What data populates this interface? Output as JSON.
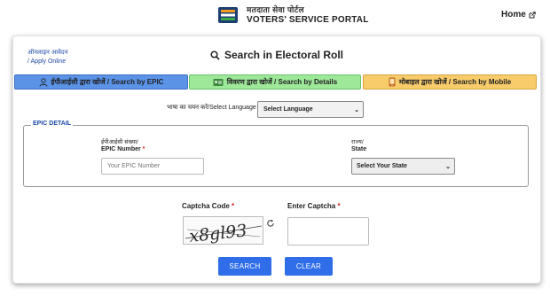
{
  "header": {
    "portal_name_hi": "मतदाता सेवा पोर्टल",
    "portal_name_en": "VOTERS' SERVICE PORTAL",
    "home_label": "Home",
    "logo_icon": "eci-logo-icon",
    "home_icon": "external-link-icon"
  },
  "card": {
    "apply_online_hi": "ऑनलाइन आवेदन",
    "apply_online_en": "/ Apply Online",
    "title": "Search in Electoral Roll",
    "title_icon": "search-icon"
  },
  "tabs": [
    {
      "label": "ईपीआईसी द्वारा खोजें / Search by EPIC",
      "icon": "user-icon",
      "color": "#5b93e7",
      "active": true
    },
    {
      "label": "विवरण द्वारा खोजें / Search by Details",
      "icon": "id-card-icon",
      "color": "#9ee89a",
      "active": false
    },
    {
      "label": "मोबाइल द्वारा खोजें / Search by Mobile",
      "icon": "mobile-icon",
      "color": "#f8cb6b",
      "active": false
    }
  ],
  "language": {
    "label": "भाषा का चयन करें/Select Language",
    "selected": "Select Language"
  },
  "epic_detail": {
    "legend": "EPIC DETAIL",
    "epic_label_hi": "ईपीआईसी संख्या/",
    "epic_label_en": "EPIC Number",
    "epic_placeholder": "Your EPIC Number",
    "state_label_hi": "राज्य/",
    "state_label_en": "State",
    "state_selected": "Select Your State"
  },
  "captcha": {
    "code_label": "Captcha Code",
    "input_label": "Enter Captcha",
    "code_text": "x8gl93",
    "refresh_icon": "refresh-icon"
  },
  "buttons": {
    "search": "SEARCH",
    "clear": "CLEAR"
  },
  "colors": {
    "primary_button": "#2f6ee8",
    "legend_blue": "#1f4aa8",
    "required": "#dd2222"
  }
}
